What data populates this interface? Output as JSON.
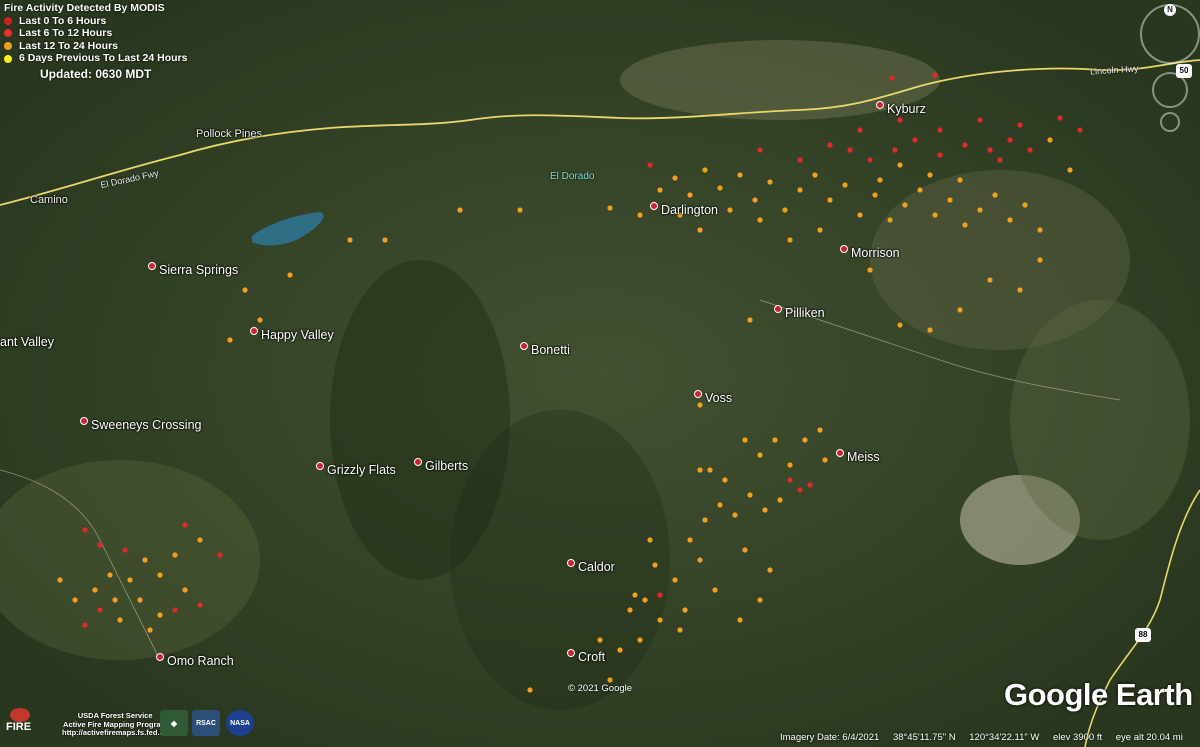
{
  "legend": {
    "title": "Fire Activity Detected By MODIS",
    "items": [
      {
        "label": "Last 0 To 6 Hours",
        "color": "#d42020"
      },
      {
        "label": "Last 6 To 12 Hours",
        "color": "#e83030"
      },
      {
        "label": "Last 12 To 24 Hours",
        "color": "#f0a020"
      },
      {
        "label": "6 Days Previous To Last 24 Hours",
        "color": "#f5f020"
      }
    ],
    "updated": "Updated: 0630 MDT"
  },
  "places": {
    "kyburz": "Kyburz",
    "pollock_pines": "Pollock Pines",
    "camino": "Camino",
    "darlington": "Darlington",
    "morrison": "Morrison",
    "sierra_springs": "Sierra Springs",
    "pilliken": "Pilliken",
    "happy_valley": "Happy Valley",
    "ant_valley": "ant Valley",
    "bonetti": "Bonetti",
    "voss": "Voss",
    "sweeneys_crossing": "Sweeneys Crossing",
    "meiss": "Meiss",
    "grizzly_flats": "Grizzly Flats",
    "gilberts": "Gilberts",
    "caldor": "Caldor",
    "croft": "Croft",
    "omo_ranch": "Omo Ranch"
  },
  "labels": {
    "el_dorado_river": "El Dorado",
    "el_dorado_fwy": "El Dorado Fwy",
    "lincoln_hwy": "Lincoln Hwy"
  },
  "shields": {
    "hwy50": "50",
    "hwy88": "88"
  },
  "compass_letter": "N",
  "copyright": "© 2021 Google",
  "google_earth": "Google Earth",
  "status": {
    "imagery_date": "Imagery Date: 6/4/2021",
    "lat": "38°45'11.75\" N",
    "lon": "120°34'22.11\" W",
    "elev": "elev  3900 ft",
    "eye_alt": "eye alt  20.04 mi"
  },
  "credit": {
    "line1": "USDA Forest Service",
    "line2": "Active Fire Mapping Program",
    "line3": "http://activefiremaps.fs.fed.us",
    "fire_logo": "FIRE",
    "rsac": "RSAC",
    "nasa": "NASA"
  },
  "colors": {
    "red": "#e02a2a",
    "orange": "#f2a01e"
  }
}
